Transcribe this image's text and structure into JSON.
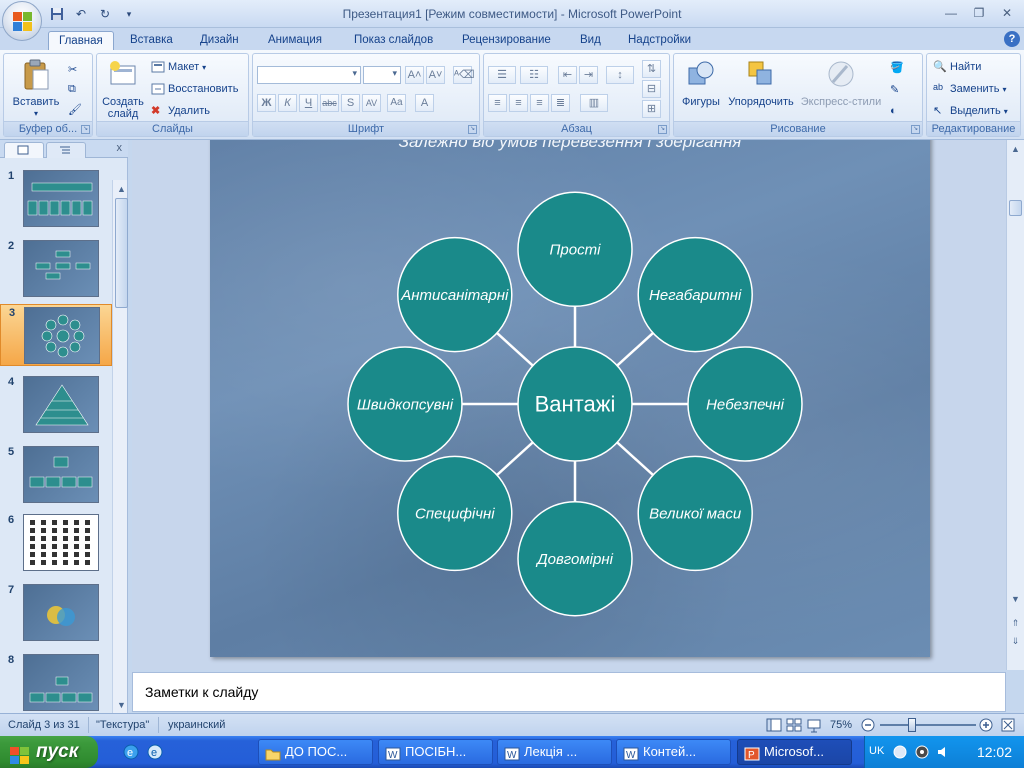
{
  "window": {
    "title": "Презентация1 [Режим совместимости] - Microsoft PowerPoint"
  },
  "tabs": [
    "Главная",
    "Вставка",
    "Дизайн",
    "Анимация",
    "Показ слайдов",
    "Рецензирование",
    "Вид",
    "Надстройки"
  ],
  "ribbon": {
    "clipboard": {
      "label": "Буфер об...",
      "paste": "Вставить"
    },
    "slides": {
      "label": "Слайды",
      "create": "Создать слайд",
      "layout": "Макет",
      "reset": "Восстановить",
      "delete": "Удалить"
    },
    "font": {
      "label": "Шрифт"
    },
    "paragraph": {
      "label": "Абзац"
    },
    "drawing": {
      "label": "Рисование",
      "shapes": "Фигуры",
      "arrange": "Упорядочить",
      "quick_styles": "Экспресс-стили"
    },
    "editing": {
      "label": "Редактирование",
      "find": "Найти",
      "replace": "Заменить",
      "select": "Выделить"
    }
  },
  "thumbnails": [
    "1",
    "2",
    "3",
    "4",
    "5",
    "6",
    "7",
    "8"
  ],
  "selected_slide": "3",
  "slide": {
    "title": "Залежно від умов перевезення і зберігання",
    "center": "Вантажі",
    "nodes": [
      "Прості",
      "Негабаритні",
      "Небезпечні",
      "Великої маси",
      "Довгомірні",
      "Специфічні",
      "Швидкопсувні",
      "Антисанітарні"
    ]
  },
  "colors": {
    "node_fill": "#1a8a8a",
    "node_border": "#ffffff",
    "connector": "#ffffff"
  },
  "notes": "Заметки к слайду",
  "status": {
    "slide_info": "Слайд 3 из 31",
    "theme": "\"Текстура\"",
    "language": "украинский",
    "zoom": "75%"
  },
  "taskbar": {
    "start": "пуск",
    "items": [
      "ДО ПОС...",
      "ПОСІБН...",
      "Лекція ...",
      "Контей...",
      "Microsof..."
    ],
    "lang": "UK",
    "clock": "12:02"
  }
}
